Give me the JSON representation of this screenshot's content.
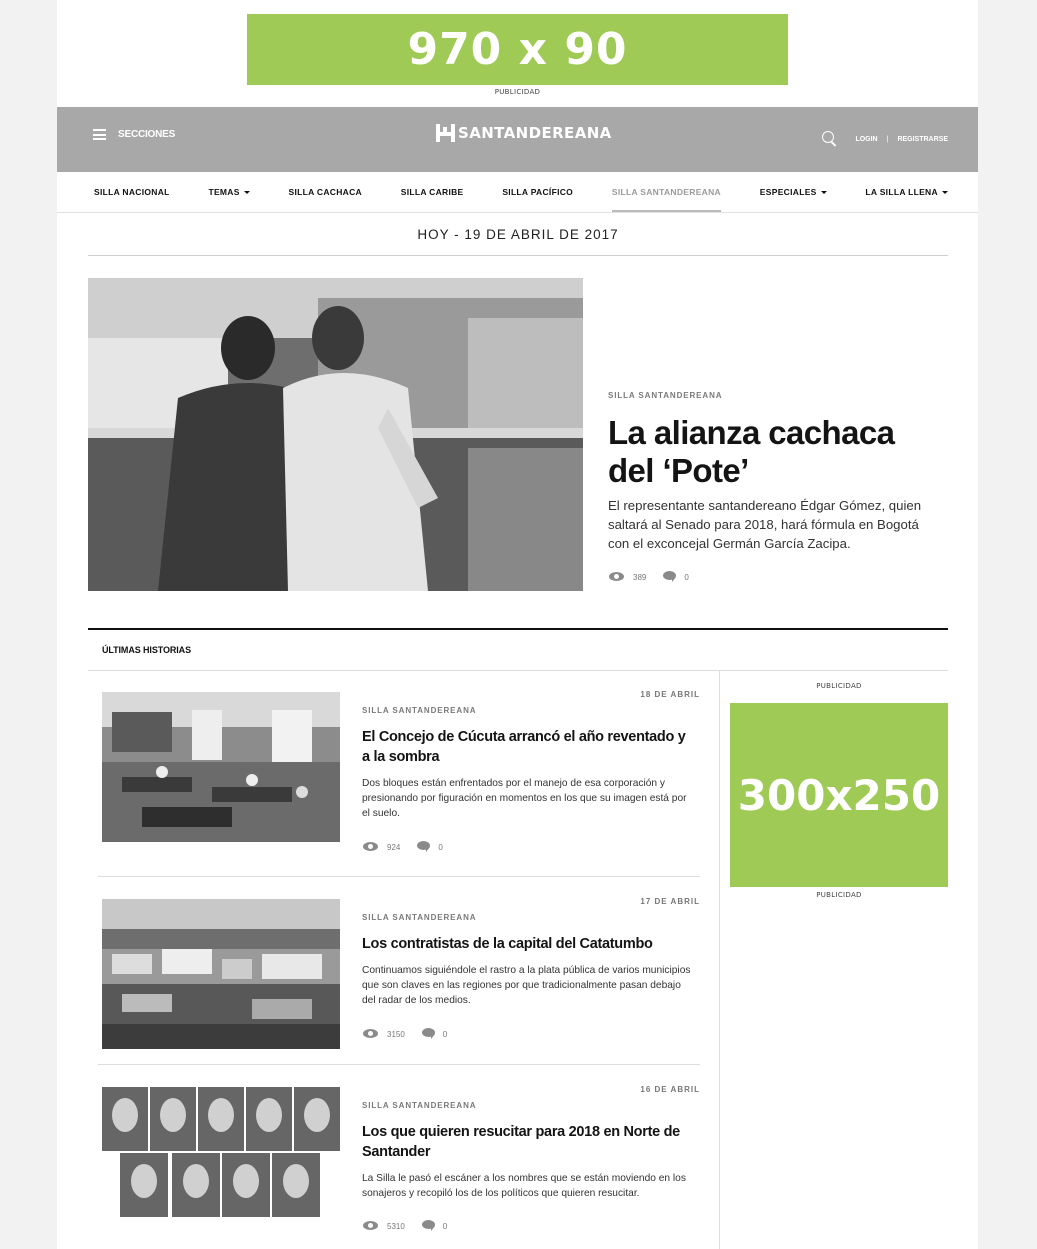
{
  "top_ad": {
    "label": "970 x 90",
    "caption": "PUBLICIDAD"
  },
  "header": {
    "menu_label": "SECCIONES",
    "logo_text": "SANTANDEREANA",
    "login": "LOGIN",
    "separator": "|",
    "register": "REGISTRARSE"
  },
  "nav": [
    {
      "label": "SILLA NACIONAL"
    },
    {
      "label": "TEMAS"
    },
    {
      "label": "SILLA CACHACA"
    },
    {
      "label": "SILLA CARIBE"
    },
    {
      "label": "SILLA PACÍFICO"
    },
    {
      "label": "SILLA SANTANDEREANA"
    },
    {
      "label": "ESPECIALES"
    },
    {
      "label": "LA SILLA LLENA"
    }
  ],
  "date_line": "HOY - 19 DE ABRIL DE 2017",
  "hero": {
    "category": "SILLA SANTANDEREANA",
    "title": "La alianza cachaca del ‘Pote’",
    "description": "El representante santandereano Édgar Gómez, quien saltará al Senado para 2018, hará fórmula en Bogotá con el exconcejal Germán García Zacipa.",
    "views": "389",
    "comments": "0"
  },
  "section_title": "ÚLTIMAS HISTORIAS",
  "articles": [
    {
      "date": "18 DE ABRIL",
      "category": "SILLA SANTANDEREANA",
      "title": "El Concejo de Cúcuta arrancó el año reventado y a la sombra",
      "description": "Dos bloques están enfrentados por el manejo de esa corporación y presionando por figuración en momentos en los que su imagen está por el suelo.",
      "views": "924",
      "comments": "0"
    },
    {
      "date": "17 DE ABRIL",
      "category": "SILLA SANTANDEREANA",
      "title": "Los contratistas de la capital del Catatumbo",
      "description": "Continuamos siguiéndole el rastro a la plata pública de varios municipios que son claves en las regiones por que tradicionalmente pasan debajo del radar de los medios.",
      "views": "3150",
      "comments": "0"
    },
    {
      "date": "16 DE ABRIL",
      "category": "SILLA SANTANDEREANA",
      "title": "Los que quieren resucitar para 2018 en Norte de Santander",
      "description": "La Silla le pasó el escáner a los nombres que se están moviendo en los sonajeros y recopiló los de los políticos que quieren resucitar.",
      "views": "5310",
      "comments": "0"
    }
  ],
  "side_ad": {
    "label": "300x250",
    "caption_top": "PUBLICIDAD",
    "caption_bottom": "PUBLICIDAD"
  },
  "colors": {
    "ad_green": "#9fca55",
    "header_gray": "#a8a8a8"
  }
}
